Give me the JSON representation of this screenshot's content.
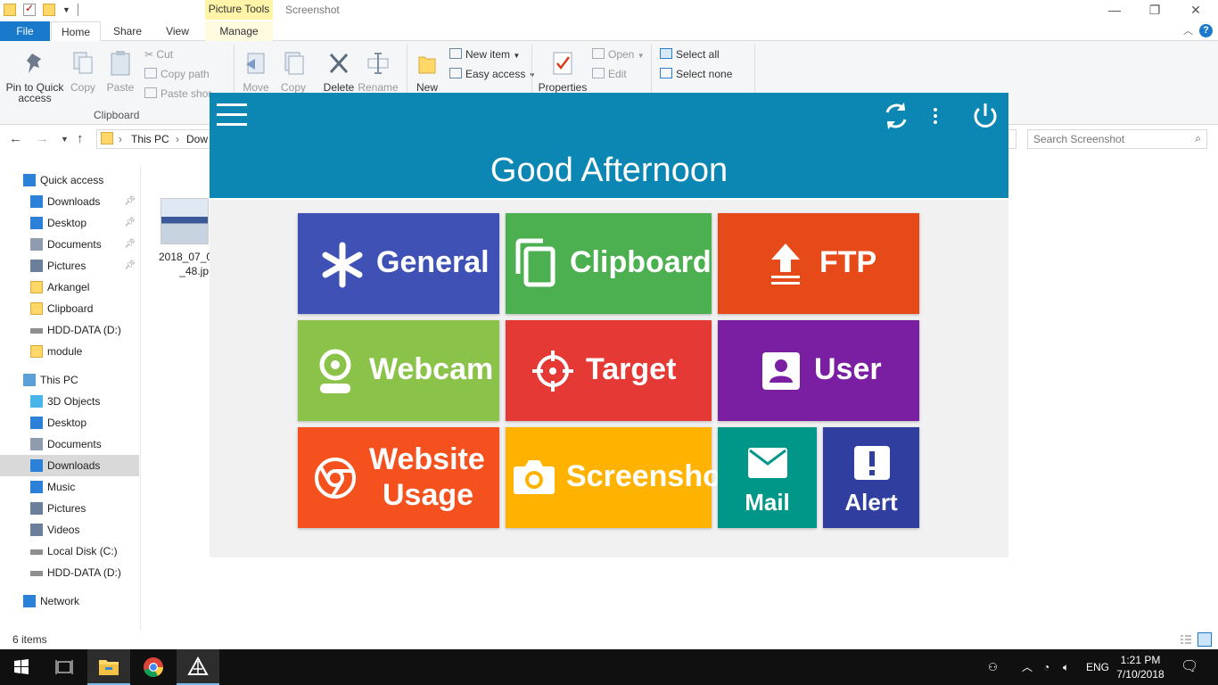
{
  "window": {
    "title": "Screenshot",
    "contextual_tab_group": "Picture Tools",
    "controls": {
      "minimize": "—",
      "restore": "❐",
      "close": "✕"
    }
  },
  "ribbon_tabs": {
    "file": "File",
    "home": "Home",
    "share": "Share",
    "view": "View",
    "manage": "Manage"
  },
  "ribbon": {
    "pin_quick_access": "Pin to Quick access",
    "copy": "Copy",
    "paste": "Paste",
    "cut": "Cut",
    "copy_path": "Copy path",
    "paste_shortcut": "Paste shor",
    "clipboard_group": "Clipboard",
    "move": "Move",
    "copy_to": "Copy",
    "delete": "Delete",
    "rename": "Rename",
    "new_folder": "New",
    "new_item": "New item",
    "easy_access": "Easy access",
    "properties": "Properties",
    "open": "Open",
    "edit": "Edit",
    "select_all": "Select all",
    "select_none": "Select none"
  },
  "address": {
    "crumbs": [
      "This PC",
      "Dow"
    ],
    "search_placeholder": "Search Screenshot"
  },
  "nav_pane": {
    "items": [
      {
        "label": "Quick access",
        "icon": "star-icon"
      },
      {
        "label": "Downloads",
        "icon": "download-icon",
        "pinned": true
      },
      {
        "label": "Desktop",
        "icon": "desktop-icon",
        "pinned": true
      },
      {
        "label": "Documents",
        "icon": "document-icon",
        "pinned": true
      },
      {
        "label": "Pictures",
        "icon": "pictures-icon",
        "pinned": true
      },
      {
        "label": "Arkangel",
        "icon": "folder-icon"
      },
      {
        "label": "Clipboard",
        "icon": "folder-icon"
      },
      {
        "label": "HDD-DATA (D:)",
        "icon": "drive-icon"
      },
      {
        "label": "module",
        "icon": "folder-icon"
      },
      {
        "label": "This PC",
        "icon": "computer-icon"
      },
      {
        "label": "3D Objects",
        "icon": "cube-icon"
      },
      {
        "label": "Desktop",
        "icon": "desktop-icon"
      },
      {
        "label": "Documents",
        "icon": "document-icon"
      },
      {
        "label": "Downloads",
        "icon": "download-icon",
        "selected": true
      },
      {
        "label": "Music",
        "icon": "music-icon"
      },
      {
        "label": "Pictures",
        "icon": "pictures-icon"
      },
      {
        "label": "Videos",
        "icon": "videos-icon"
      },
      {
        "label": "Local Disk (C:)",
        "icon": "drive-icon"
      },
      {
        "label": "HDD-DATA (D:)",
        "icon": "drive-icon"
      },
      {
        "label": "Network",
        "icon": "network-icon"
      }
    ]
  },
  "file_item": {
    "label_line1": "2018_07_0",
    "label_line2": "_48.jp"
  },
  "status": {
    "items": "6 items"
  },
  "app": {
    "greeting": "Good Afternoon",
    "header_color": "#0c87b3",
    "tiles": [
      {
        "id": "general",
        "label": "General",
        "icon": "asterisk-icon",
        "color": "#3f51b5"
      },
      {
        "id": "clipboard",
        "label": "Clipboard",
        "icon": "clipboard-copy-icon",
        "color": "#4caf50"
      },
      {
        "id": "ftp",
        "label": "FTP",
        "icon": "upload-icon",
        "color": "#e64a19"
      },
      {
        "id": "webcam",
        "label": "Webcam",
        "icon": "webcam-icon",
        "color": "#8bc34a"
      },
      {
        "id": "target",
        "label": "Target",
        "icon": "crosshair-icon",
        "color": "#e53935"
      },
      {
        "id": "user",
        "label": "User",
        "icon": "user-icon",
        "color": "#7b1fa2"
      },
      {
        "id": "website",
        "label_line1": "Website",
        "label_line2": "Usage",
        "icon": "chrome-icon",
        "color": "#f4511e"
      },
      {
        "id": "screenshot",
        "label": "Screenshot",
        "icon": "camera-icon",
        "color": "#ffb300"
      },
      {
        "id": "mail",
        "label": "Mail",
        "icon": "mail-icon",
        "color": "#009688"
      },
      {
        "id": "alert",
        "label": "Alert",
        "icon": "alert-icon",
        "color": "#303f9f"
      }
    ]
  },
  "taskbar": {
    "language": "ENG",
    "time": "1:21 PM",
    "date": "7/10/2018"
  }
}
